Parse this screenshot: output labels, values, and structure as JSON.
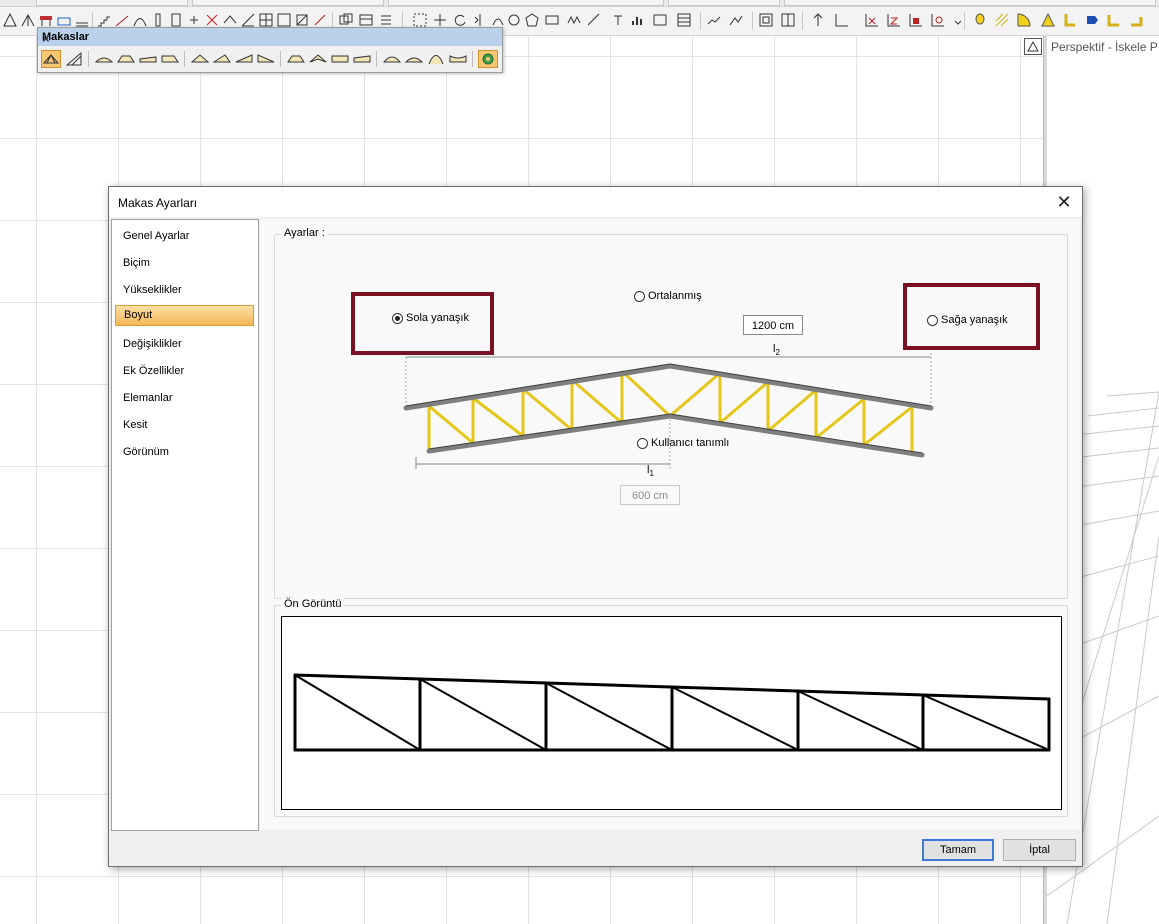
{
  "perspective": {
    "label": "Perspektif - İskele P"
  },
  "makaslar": {
    "title": "Makaslar",
    "close_glyph": "×"
  },
  "dialog": {
    "title": "Makas Ayarları",
    "close_glyph": "✕",
    "nav": [
      {
        "label": "Genel Ayarlar",
        "selected": false
      },
      {
        "label": "Biçim",
        "selected": false
      },
      {
        "label": "Yükseklikler",
        "selected": false
      },
      {
        "label": "Boyut",
        "selected": true
      },
      {
        "label": "Değişiklikler",
        "selected": false
      },
      {
        "label": "Ek Özellikler",
        "selected": false
      },
      {
        "label": "Elemanlar",
        "selected": false
      },
      {
        "label": "Kesit",
        "selected": false
      },
      {
        "label": "Görünüm",
        "selected": false
      }
    ],
    "settings_group_label": "Ayarlar :",
    "options": {
      "left": {
        "label": "Sola yanaşık",
        "checked": true
      },
      "centered": {
        "label": "Ortalanmış",
        "checked": false
      },
      "right": {
        "label": "Sağa yanaşık",
        "checked": false
      },
      "custom": {
        "label": "Kullanıcı tanımlı",
        "checked": false
      }
    },
    "l2": {
      "label_main": "l",
      "label_sub": "2",
      "value": "1200 cm"
    },
    "l1": {
      "label_main": "l",
      "label_sub": "1",
      "value": "600 cm"
    },
    "preview_group_label": "Ön Görüntü",
    "buttons": {
      "ok": "Tamam",
      "cancel": "İptal"
    }
  },
  "colors": {
    "highlight": "#7b1023",
    "nav_selected": "#f5b657",
    "truss_web": "#e6c619",
    "truss_chord": "#8e8e8e"
  }
}
